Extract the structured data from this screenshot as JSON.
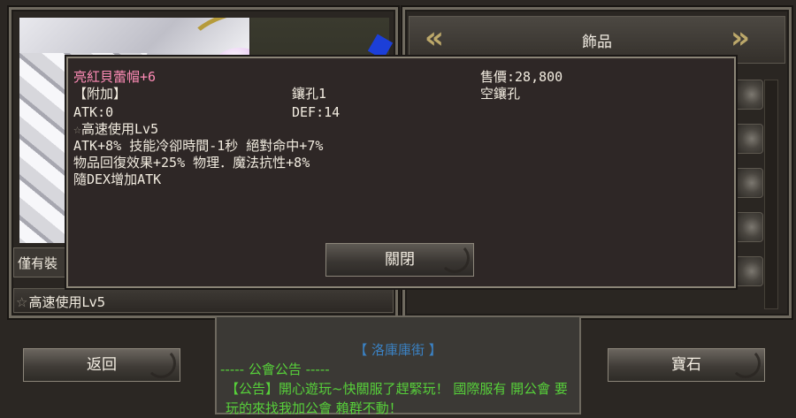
{
  "colors": {
    "item_name": "#ff8cb7",
    "notice_green": "#57d13a",
    "notice_blue": "#3b82c4",
    "gold_chevron": "#bca86a"
  },
  "category": {
    "title": "飾品",
    "prev_icon": "double-chevron-left-icon",
    "next_icon": "double-chevron-right-icon"
  },
  "equip_filter_label": "僅有裝",
  "bottom_skill": "高速使用Lv5",
  "popup": {
    "item_name": "亮紅貝蕾帽",
    "item_plus": "+6",
    "price": "售價:28,800",
    "attach_label": "【附加】",
    "socket_label": "鑲孔1",
    "socket_status": "空鑲孔",
    "atk": "ATK:0",
    "def": "DEF:14",
    "skill": "高速使用Lv5",
    "effect_line1": "ATK+8% 技能冷卻時間-1秒 絕對命中+7%",
    "effect_line2": "物品回復效果+25% 物理．魔法抗性+8%",
    "effect_line3": "隨DEX增加ATK",
    "close_label": "關閉"
  },
  "buttons": {
    "back_label": "返回",
    "gem_label": "寶石"
  },
  "notice": {
    "location": "【  洛庫庫街  】",
    "header": "-----  公會公告  -----",
    "message": "【公告】開心遊玩~快關服了趕緊玩！ 國際服有 開公會  要玩的來找我加公會  賴群不動！"
  }
}
